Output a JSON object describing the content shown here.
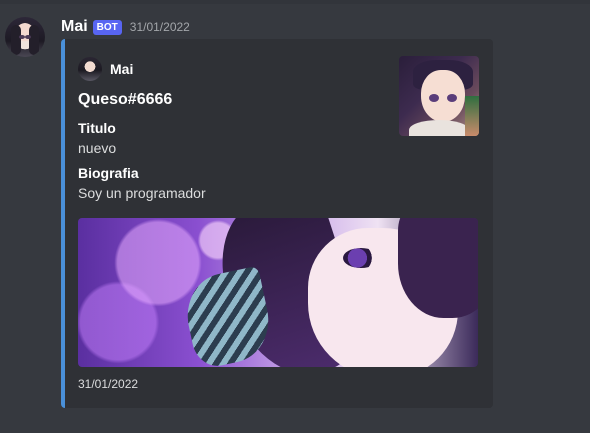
{
  "message": {
    "username": "Mai",
    "bot_tag": "BOT",
    "timestamp": "31/01/2022"
  },
  "embed": {
    "accent_color": "#4a90d9",
    "author": "Mai",
    "title": "Queso#6666",
    "fields": [
      {
        "name": "Titulo",
        "value": "nuevo"
      },
      {
        "name": "Biografia",
        "value": "Soy un programador"
      }
    ],
    "footer": "31/01/2022"
  },
  "colors": {
    "background": "#36393f",
    "embed_background": "#2f3136",
    "bot_tag": "#5865f2"
  }
}
